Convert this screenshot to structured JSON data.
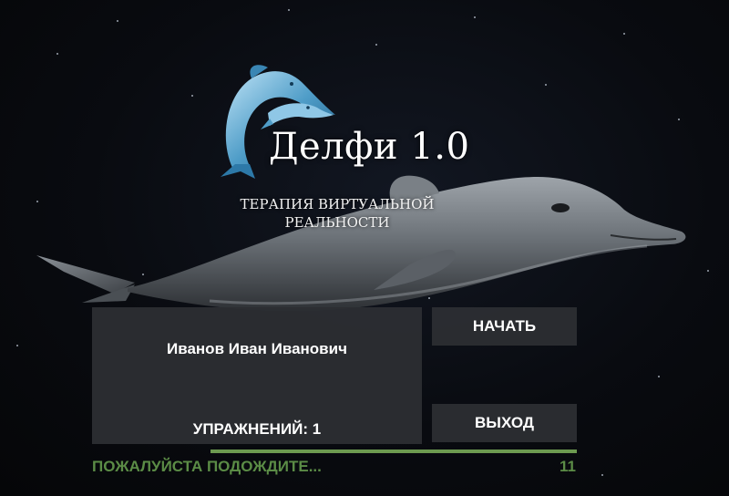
{
  "app": {
    "title": "Делфи 1.0",
    "subtitle_line1": "ТЕРАПИЯ ВИРТУАЛЬНОЙ",
    "subtitle_line2": "РЕАЛЬНОСТИ"
  },
  "user_panel": {
    "name": "Иванов Иван Иванович",
    "exercises_label": "УПРАЖНЕНИЙ: 1"
  },
  "buttons": {
    "start_label": "НАЧАТЬ",
    "exit_label": "ВЫХОД"
  },
  "status": {
    "message": "ПОЖАЛУЙСТА ПОДОЖДИТЕ...",
    "counter": "11",
    "progress_percent": 100
  },
  "icons": {
    "logo": "dolphin-logo-icon",
    "background": "dolphin-illustration"
  },
  "colors": {
    "background": "#07090d",
    "panel": "#2c2e32",
    "status_green": "#5b8c46",
    "progress_green": "#6c9a50"
  }
}
